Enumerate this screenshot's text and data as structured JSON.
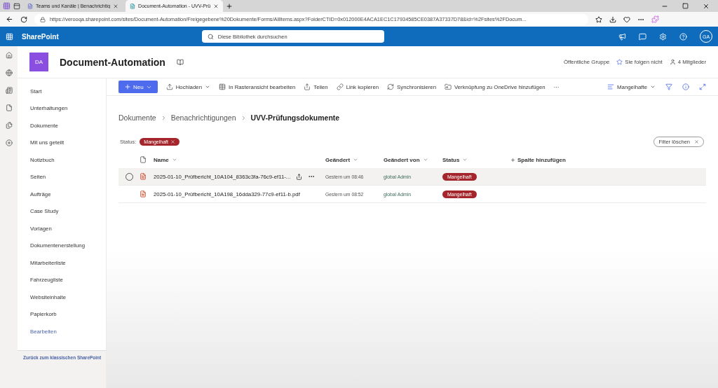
{
  "browser": {
    "tabs": [
      {
        "title": "Teams und Kanäle | Benachrichtig",
        "selected": false
      },
      {
        "title": "Document-Automation - UVV-Prü",
        "selected": true
      }
    ],
    "url": "https://verooqa.sharepoint.com/sites/Document-Automation/Freigegebene%20Dokumente/Forms/AllItems.aspx?FolderCTID=0x012000E4ACA1EC1C17934585CE0387A37337D78&id=%2Fsites%2FDocum..."
  },
  "suite_bar": {
    "app_name": "SharePoint",
    "search": {
      "placeholder": "Diese Bibliothek durchsuchen"
    },
    "avatar": "GA"
  },
  "site": {
    "logo": "DA",
    "title": "Document-Automation",
    "group_type": "Öffentliche Gruppe",
    "follow": "Sie folgen nicht",
    "members": "4 Mitglieder"
  },
  "nav": {
    "items": [
      {
        "label": "Start",
        "kind": "item"
      },
      {
        "label": "Unterhaltungen",
        "kind": "item"
      },
      {
        "label": "Dokumente",
        "kind": "item"
      },
      {
        "label": "Mit uns geteilt",
        "kind": "item"
      },
      {
        "label": "Notizbuch",
        "kind": "item"
      },
      {
        "label": "Seiten",
        "kind": "item"
      },
      {
        "label": "Aufträge",
        "kind": "item"
      },
      {
        "label": "Case Study",
        "kind": "item"
      },
      {
        "label": "Vorlagen",
        "kind": "item"
      },
      {
        "label": "Dokumentenerstellung",
        "kind": "item"
      },
      {
        "label": "Mitarbeiterliste",
        "kind": "item"
      },
      {
        "label": "Fahrzeugliste",
        "kind": "item"
      },
      {
        "label": "Websiteinhalte",
        "kind": "item"
      },
      {
        "label": "Papierkorb",
        "kind": "item"
      },
      {
        "label": "Bearbeiten",
        "kind": "link"
      }
    ],
    "footer": "Zurück zum klassischen SharePoint"
  },
  "command_bar": {
    "new": "Neu",
    "actions": [
      {
        "label": "Hochladen",
        "kind": "upload"
      },
      {
        "label": "In Rasteransicht bearbeiten",
        "kind": "grid"
      },
      {
        "label": "Teilen",
        "kind": "share"
      },
      {
        "label": "Link kopieren",
        "kind": "link"
      },
      {
        "label": "Synchronisieren",
        "kind": "sync"
      },
      {
        "label": "Verknüpfung zu OneDrive hinzufügen",
        "kind": "shortcut"
      }
    ],
    "more": "···",
    "view": "Mangelhafte"
  },
  "breadcrumb": [
    {
      "label": "Dokumente",
      "current": false
    },
    {
      "label": "Benachrichtigungen",
      "current": false
    },
    {
      "label": "UVV-Prüfungsdokumente",
      "current": true
    }
  ],
  "filter": {
    "label": "Status:",
    "chip": "Mangelhaft",
    "clear": "Filter löschen"
  },
  "table": {
    "columns": [
      "Name",
      "Geändert",
      "Geändert von",
      "Status"
    ],
    "add_column": "Spalte hinzufügen",
    "rows": [
      {
        "name": "2025-01-10_Prüfbericht_10A104_8363c3fa-76c9-ef11-...",
        "modified": "Gestern um 08:46",
        "modified_by": "global Admin",
        "status": "Mangelhaft",
        "hovered": true
      },
      {
        "name": "2025-01-10_Prüfbericht_10A198_16dda329-77c9-ef11-b.pdf",
        "modified": "Gestern um 08:52",
        "modified_by": "global Admin",
        "status": "Mangelhaft",
        "hovered": false
      }
    ]
  }
}
